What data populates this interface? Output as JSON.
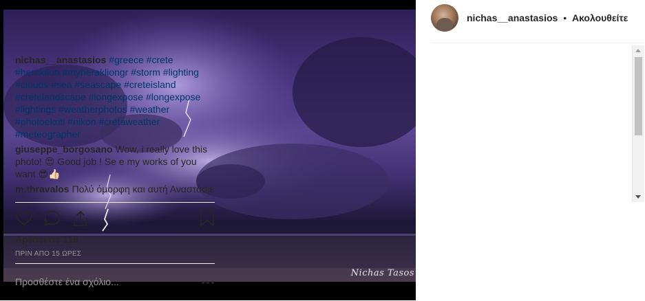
{
  "post": {
    "username": "nichas__anastasios",
    "separator": "•",
    "follow_label": "Ακολουθείτε",
    "caption_user": "nichas__anastasios",
    "caption_tags": [
      "#greece",
      "#crete",
      "#heraklion",
      "#myherakliongr",
      "#storm",
      "#lighting",
      "#clouds",
      "#sea",
      "#seascape",
      "#creteisland",
      "#cretelandscape",
      "#longexpose",
      "#longexpose",
      "#lightings",
      "#weatherphotos",
      "#weather",
      "#photoekriti",
      "#nikon",
      "#cretaweather",
      "#meteographer"
    ],
    "watermark": "Nichas Tasos"
  },
  "comments": [
    {
      "user": "giuseppe_borgosano",
      "text": "Wow, i really love this photo! 😍 Good job ! Se e my works of you want 😎👍🏻"
    },
    {
      "user": "m.thravalos",
      "text": "Πολύ όμορφη και αυτή Αναστάσιε"
    }
  ],
  "actions": {
    "like_icon": "heart-icon",
    "comment_icon": "comment-icon",
    "share_icon": "share-icon",
    "save_icon": "bookmark-icon"
  },
  "likes_text": "Αρέσει σε 116",
  "timestamp": "ΠΡΙΝ ΑΠΟ 15 ΩΡΕΣ",
  "add_comment_placeholder": "Προσθέστε ένα σχόλιο...",
  "more_icon": "more-options-icon"
}
